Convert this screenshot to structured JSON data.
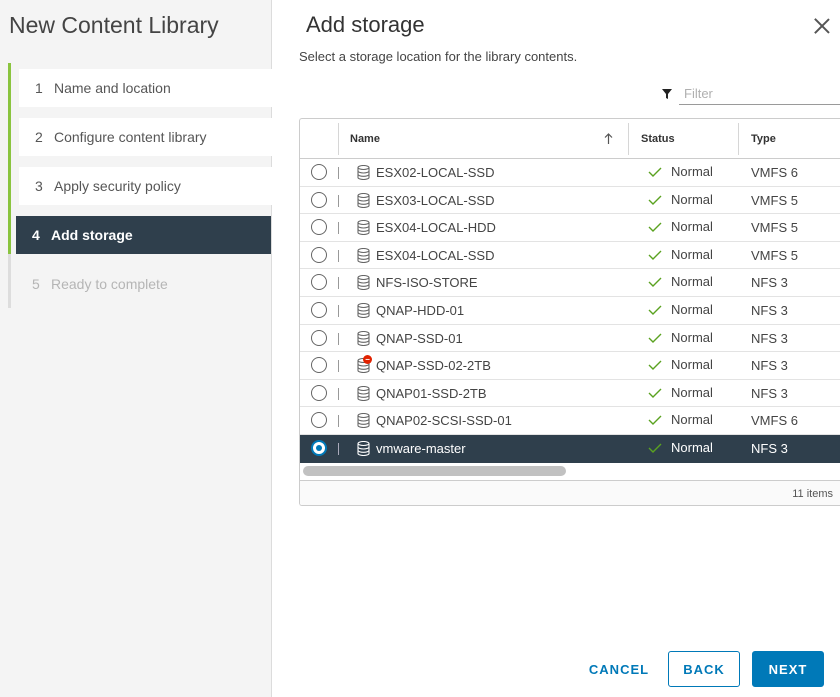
{
  "wizard": {
    "title": "New Content Library",
    "steps": [
      {
        "num": "1",
        "label": "Name and location"
      },
      {
        "num": "2",
        "label": "Configure content library"
      },
      {
        "num": "3",
        "label": "Apply security policy"
      },
      {
        "num": "4",
        "label": "Add storage"
      },
      {
        "num": "5",
        "label": "Ready to complete"
      }
    ]
  },
  "page": {
    "heading": "Add storage",
    "subtitle": "Select a storage location for the library contents."
  },
  "filter": {
    "placeholder": "Filter",
    "value": ""
  },
  "grid": {
    "columns": {
      "name": "Name",
      "status": "Status",
      "type": "Type"
    },
    "rows": [
      {
        "name": "ESX02-LOCAL-SSD",
        "status": "Normal",
        "type": "VMFS 6"
      },
      {
        "name": "ESX03-LOCAL-SSD",
        "status": "Normal",
        "type": "VMFS 5"
      },
      {
        "name": "ESX04-LOCAL-HDD",
        "status": "Normal",
        "type": "VMFS 5"
      },
      {
        "name": "ESX04-LOCAL-SSD",
        "status": "Normal",
        "type": "VMFS 5"
      },
      {
        "name": "NFS-ISO-STORE",
        "status": "Normal",
        "type": "NFS 3"
      },
      {
        "name": "QNAP-HDD-01",
        "status": "Normal",
        "type": "NFS 3"
      },
      {
        "name": "QNAP-SSD-01",
        "status": "Normal",
        "type": "NFS 3"
      },
      {
        "name": "QNAP-SSD-02-2TB",
        "status": "Normal",
        "type": "NFS 3"
      },
      {
        "name": "QNAP01-SSD-2TB",
        "status": "Normal",
        "type": "NFS 3"
      },
      {
        "name": "QNAP02-SCSI-SSD-01",
        "status": "Normal",
        "type": "VMFS 6"
      },
      {
        "name": "vmware-master",
        "status": "Normal",
        "type": "NFS 3"
      }
    ],
    "selected_row": "vmware-master",
    "footer": "11 items"
  },
  "buttons": {
    "cancel": "CANCEL",
    "back": "BACK",
    "next": "NEXT"
  },
  "colors": {
    "accent": "#0079b8",
    "selected_bg": "#2f3f4c",
    "completed_step": "#8ac43f",
    "status_ok": "#5aa220",
    "alert": "#e12200"
  }
}
